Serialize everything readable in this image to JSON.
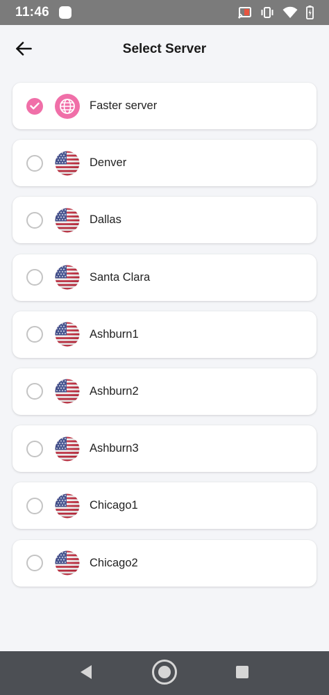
{
  "status_bar": {
    "time": "11:46",
    "icons": [
      "notification-icon",
      "cast-icon",
      "vibrate-icon",
      "wifi-icon",
      "battery-icon"
    ]
  },
  "header": {
    "title": "Select Server",
    "back_icon": "back-arrow-icon"
  },
  "colors": {
    "accent": "#f06fa8",
    "card_bg": "#ffffff",
    "page_bg": "#f4f5f8"
  },
  "servers": [
    {
      "name": "Faster server",
      "icon": "globe-icon",
      "selected": true
    },
    {
      "name": "Denver",
      "icon": "us-flag-icon",
      "selected": false
    },
    {
      "name": "Dallas",
      "icon": "us-flag-icon",
      "selected": false
    },
    {
      "name": "Santa Clara",
      "icon": "us-flag-icon",
      "selected": false
    },
    {
      "name": "Ashburn1",
      "icon": "us-flag-icon",
      "selected": false
    },
    {
      "name": "Ashburn2",
      "icon": "us-flag-icon",
      "selected": false
    },
    {
      "name": "Ashburn3",
      "icon": "us-flag-icon",
      "selected": false
    },
    {
      "name": "Chicago1",
      "icon": "us-flag-icon",
      "selected": false
    },
    {
      "name": "Chicago2",
      "icon": "us-flag-icon",
      "selected": false
    }
  ],
  "nav_bar": {
    "buttons": [
      "back-triangle-icon",
      "home-circle-icon",
      "recents-square-icon"
    ]
  }
}
